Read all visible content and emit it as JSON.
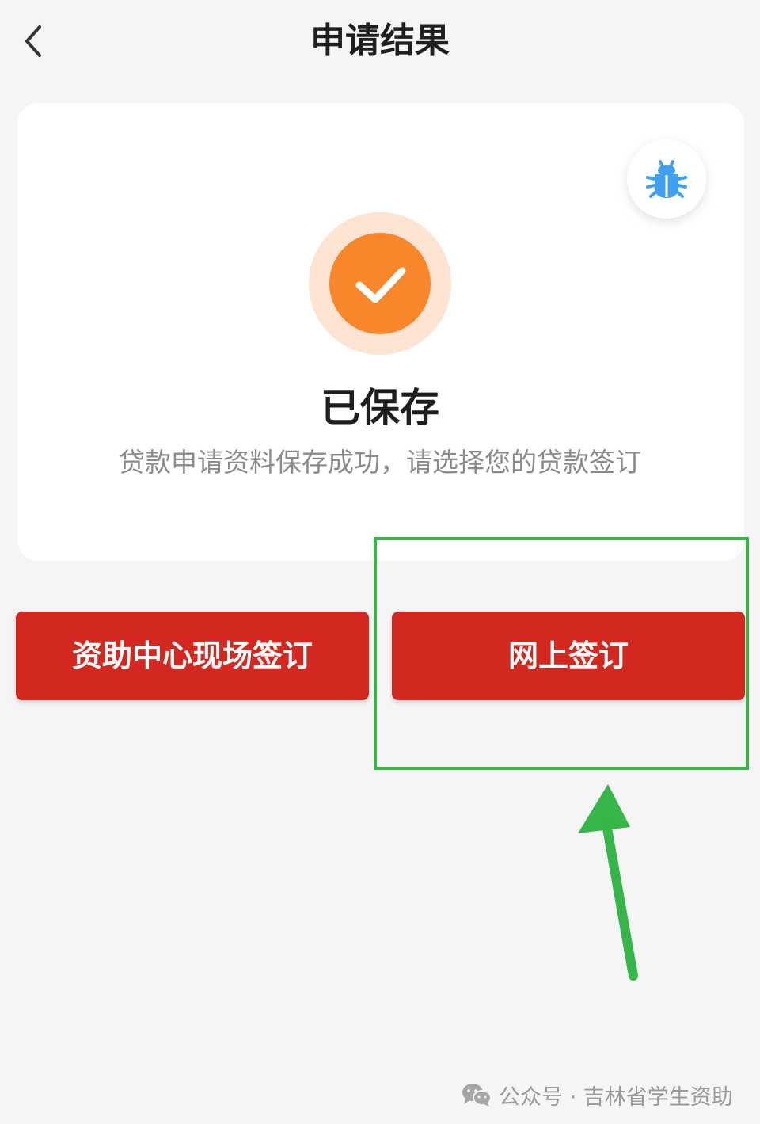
{
  "header": {
    "title": "申请结果",
    "back_icon": "chevron-left-icon"
  },
  "result": {
    "status_icon": "check-circle-icon",
    "status_title": "已保存",
    "description": "贷款申请资料保存成功，请选择您的贷款签订",
    "debug_icon": "bug-icon"
  },
  "actions": {
    "onsite_label": "资助中心现场签订",
    "online_label": "网上签订"
  },
  "annotation": {
    "highlight_color": "#36b549"
  },
  "watermark": {
    "icon": "wechat-icon",
    "text": "公众号 · 吉林省学生资助"
  },
  "colors": {
    "primary_red": "#d3281f",
    "accent_orange": "#f7872a",
    "bug_blue": "#3f9ff0"
  }
}
